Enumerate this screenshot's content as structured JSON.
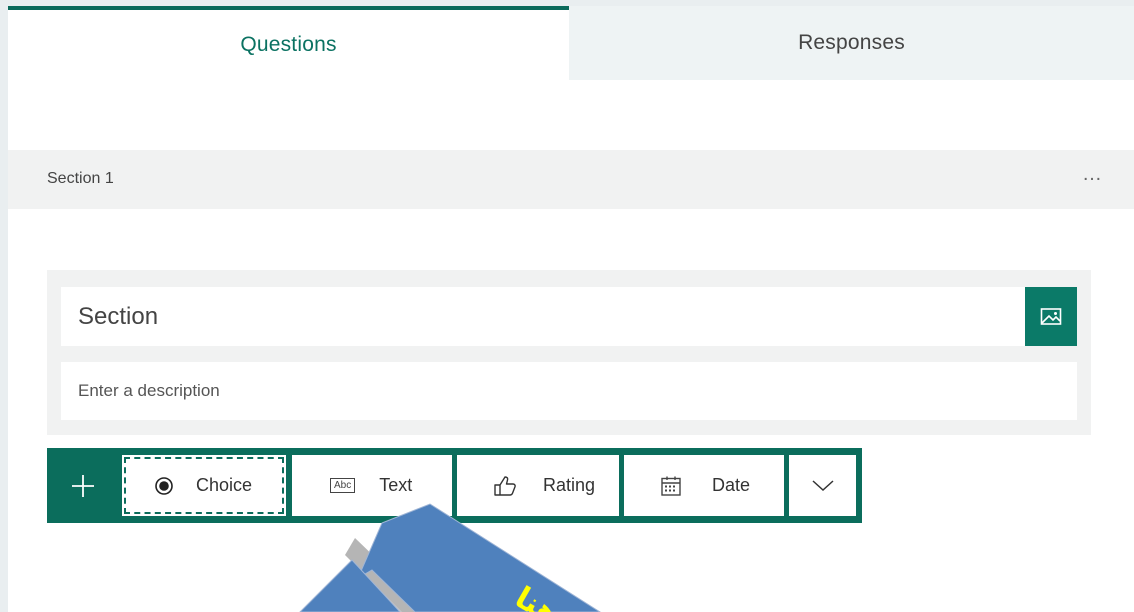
{
  "tabs": [
    {
      "label": "Questions",
      "active": true
    },
    {
      "label": "Responses",
      "active": false
    }
  ],
  "section_header": {
    "label": "Section 1",
    "more": "…"
  },
  "section_card": {
    "title_value": "Section",
    "description_placeholder": "Enter a description"
  },
  "toolbar": {
    "add_icon": "plus-icon",
    "buttons": [
      {
        "label": "Choice",
        "icon": "radio-icon"
      },
      {
        "label": "Text",
        "icon": "abc-text-icon",
        "icon_text": "Abc"
      },
      {
        "label": "Rating",
        "icon": "thumbs-up-icon"
      },
      {
        "label": "Date",
        "icon": "calendar-icon"
      },
      {
        "label": "",
        "icon": "chevron-down-icon"
      }
    ]
  },
  "colors": {
    "accent": "#0b6d5c",
    "tab_active_text": "#0b7262",
    "callout_fill": "#4f81bd",
    "callout_text": "#ffff00"
  },
  "callout": {
    "text": "هنا"
  }
}
